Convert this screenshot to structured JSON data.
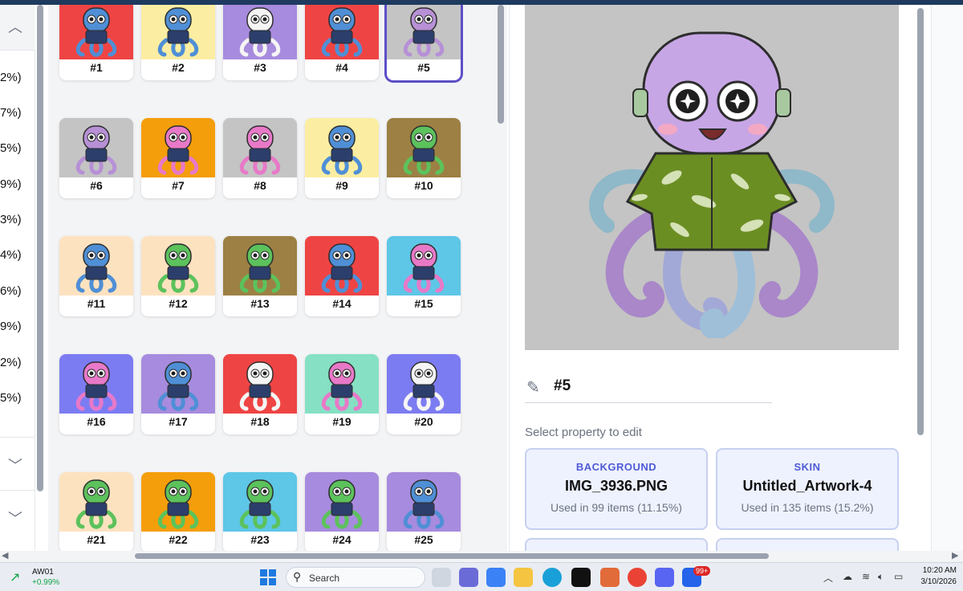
{
  "sidebar": {
    "percentages": [
      "2%)",
      "7%)",
      "5%)",
      "9%)",
      "3%)",
      "4%)",
      "6%)",
      "9%)",
      "2%)",
      "5%)"
    ]
  },
  "grid": {
    "items": [
      {
        "label": "#1",
        "bg": "#ef4444",
        "body": "#4f8fd6"
      },
      {
        "label": "#2",
        "bg": "#fbeea2",
        "body": "#4f8fd6"
      },
      {
        "label": "#3",
        "bg": "#a78bde",
        "body": "#f5f5f5"
      },
      {
        "label": "#4",
        "bg": "#ef4444",
        "body": "#4f8fd6"
      },
      {
        "label": "#5",
        "bg": "#c4c4c4",
        "body": "#b790d6"
      },
      {
        "label": "#6",
        "bg": "#c4c4c4",
        "body": "#b790d6"
      },
      {
        "label": "#7",
        "bg": "#f59e0b",
        "body": "#e879c8"
      },
      {
        "label": "#8",
        "bg": "#c4c4c4",
        "body": "#e879c8"
      },
      {
        "label": "#9",
        "bg": "#fbeea2",
        "body": "#4f8fd6"
      },
      {
        "label": "#10",
        "bg": "#9c8044",
        "body": "#5cc25c"
      },
      {
        "label": "#11",
        "bg": "#fde2c0",
        "body": "#4f8fd6"
      },
      {
        "label": "#12",
        "bg": "#fde2c0",
        "body": "#5cc25c"
      },
      {
        "label": "#13",
        "bg": "#9c8044",
        "body": "#5cc25c"
      },
      {
        "label": "#14",
        "bg": "#ef4444",
        "body": "#4f8fd6"
      },
      {
        "label": "#15",
        "bg": "#5ec6e6",
        "body": "#e879c8"
      },
      {
        "label": "#16",
        "bg": "#7c7cf2",
        "body": "#e879c8"
      },
      {
        "label": "#17",
        "bg": "#a78bde",
        "body": "#4f8fd6"
      },
      {
        "label": "#18",
        "bg": "#ef4444",
        "body": "#f5f5f5"
      },
      {
        "label": "#19",
        "bg": "#86e0c4",
        "body": "#e879c8"
      },
      {
        "label": "#20",
        "bg": "#7c7cf2",
        "body": "#f5f5f5"
      },
      {
        "label": "#21",
        "bg": "#fde2c0",
        "body": "#5cc25c"
      },
      {
        "label": "#22",
        "bg": "#f59e0b",
        "body": "#5cc25c"
      },
      {
        "label": "#23",
        "bg": "#5ec6e6",
        "body": "#5cc25c"
      },
      {
        "label": "#24",
        "bg": "#a78bde",
        "body": "#5cc25c"
      },
      {
        "label": "#25",
        "bg": "#a78bde",
        "body": "#4f8fd6"
      }
    ]
  },
  "detail": {
    "name": "#5",
    "select_prompt": "Select property to edit",
    "cards": [
      {
        "title": "BACKGROUND",
        "value": "IMG_3936.PNG",
        "usage": "Used in 99 items (11.15%)"
      },
      {
        "title": "SKIN",
        "value": "Untitled_Artwork-4",
        "usage": "Used in 135 items (15.2%)"
      }
    ]
  },
  "taskbar": {
    "stock_symbol": "AW01",
    "stock_change": "+0.99%",
    "search_placeholder": "Search",
    "notification_badge": "99+",
    "time": "10:20 AM",
    "date": "3/10/2026"
  },
  "colors": {
    "accent": "#5b4fc7",
    "card_title": "#4f5bd5",
    "card_bg": "#eef2ff"
  }
}
